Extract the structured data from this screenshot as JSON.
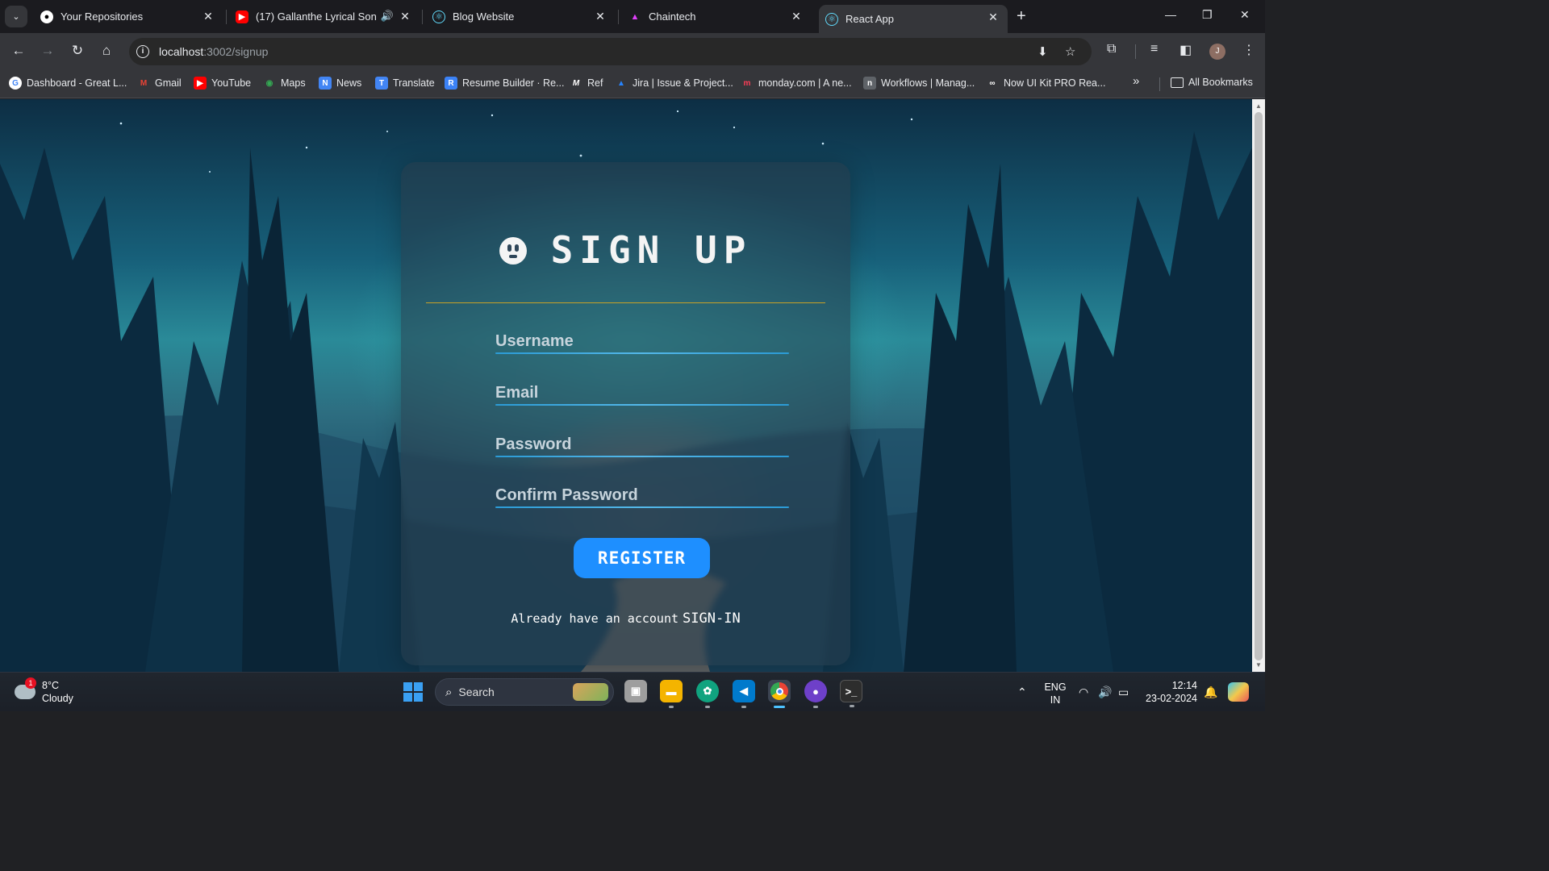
{
  "browser": {
    "tabs": [
      {
        "title": "Your Repositories",
        "icon": "github-icon"
      },
      {
        "title": "(17) Gallanthe Lyrical Song |",
        "icon": "youtube-icon",
        "audio": true
      },
      {
        "title": "Blog Website",
        "icon": "react-icon"
      },
      {
        "title": "Chaintech",
        "icon": "chaintech-icon"
      },
      {
        "title": "React App",
        "icon": "react-icon",
        "active": true
      }
    ],
    "url": {
      "host": "localhost",
      "path": ":3002/signup"
    },
    "bookmarks": [
      {
        "label": "Dashboard - Great L...",
        "icon": "G",
        "color": "#4285f4"
      },
      {
        "label": "Gmail",
        "icon": "M",
        "color": "#ea4335"
      },
      {
        "label": "YouTube",
        "icon": "▶",
        "color": "#ff0000"
      },
      {
        "label": "Maps",
        "icon": "◉",
        "color": "#34a853"
      },
      {
        "label": "News",
        "icon": "N",
        "color": "#4285f4"
      },
      {
        "label": "Translate",
        "icon": "T",
        "color": "#4285f4"
      },
      {
        "label": "Resume Builder · Re...",
        "icon": "R",
        "color": "#3b82f6"
      },
      {
        "label": "Ref",
        "icon": "M",
        "color": "#444444"
      },
      {
        "label": "Jira | Issue & Project...",
        "icon": "▲",
        "color": "#2684ff"
      },
      {
        "label": "monday.com | A ne...",
        "icon": "m",
        "color": "#ff3d57"
      },
      {
        "label": "Workflows | Manag...",
        "icon": "n",
        "color": "#5f6368"
      },
      {
        "label": "Now UI Kit PRO Rea...",
        "icon": "∞",
        "color": "#222222"
      }
    ],
    "all_bookmarks": "All Bookmarks",
    "profile_initial": "J"
  },
  "signup": {
    "title": "SIGN UP",
    "fields": {
      "username": "Username",
      "email": "Email",
      "password": "Password",
      "confirm": "Confirm Password"
    },
    "register": "REGISTER",
    "signin_prompt": "Already have an account",
    "signin_link": "SIGN-IN",
    "accent_rule": "#c9a227",
    "button_color": "#1e8fff"
  },
  "taskbar": {
    "weather_temp": "8°C",
    "weather_desc": "Cloudy",
    "weather_badge": "1",
    "search": "Search",
    "lang_top": "ENG",
    "lang_bottom": "IN",
    "time": "12:14",
    "date": "23-02-2024"
  }
}
